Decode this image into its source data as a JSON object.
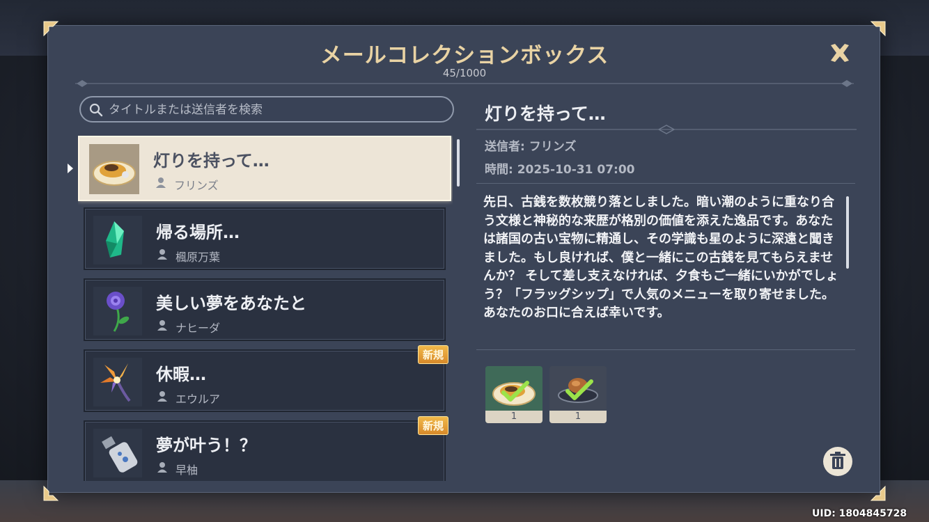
{
  "window": {
    "title": "メールコレクションボックス",
    "count": "45/1000"
  },
  "search": {
    "placeholder": "タイトルまたは送信者を検索"
  },
  "mails": [
    {
      "title": "灯りを持って…",
      "sender": "フリンズ",
      "icon": "fried-rice-dish-icon",
      "selected": true,
      "new_badge": ""
    },
    {
      "title": "帰る場所…",
      "sender": "楓原万葉",
      "icon": "green-crystal-icon",
      "selected": false,
      "new_badge": ""
    },
    {
      "title": "美しい夢をあなたと",
      "sender": "ナヒーダ",
      "icon": "purple-rose-icon",
      "selected": false,
      "new_badge": ""
    },
    {
      "title": "休暇…",
      "sender": "エウルア",
      "icon": "orange-flower-icon",
      "selected": false,
      "new_badge": "新規"
    },
    {
      "title": "夢が叶う！？",
      "sender": "早柚",
      "icon": "spray-can-icon",
      "selected": false,
      "new_badge": "新規"
    }
  ],
  "detail": {
    "title": "灯りを持って…",
    "sender": "送信者: フリンズ",
    "time": "時間: 2025-10-31 07:00",
    "body": "先日、古銭を数枚競り落としました。暗い潮のように重なり合う文様と神秘的な来歴が格別の価値を添えた逸品です。あなたは諸国の古い宝物に精通し、その学識も星のように深遠と聞きました。もし良ければ、僕と一緒にこの古銭を見てもらえませんか？ そして差し支えなければ、夕食もご一緒にいかがでしょう？「フラッグシップ」で人気のメニューを取り寄せました。あなたのお口に合えば幸いです。",
    "rewards": [
      {
        "icon": "fried-rice-dish-icon",
        "qty": "1",
        "claimed": true
      },
      {
        "icon": "roast-meat-dish-icon",
        "qty": "1",
        "claimed": true
      }
    ]
  },
  "footer": {
    "uid": "UID: 1804845728"
  },
  "colors": {
    "panel_bg": "#3b4457",
    "title_gold": "#e9d3a4",
    "selected_item_bg": "#ede5d7",
    "new_badge": "#e8a43a",
    "claimed_check": "#9be34a"
  }
}
